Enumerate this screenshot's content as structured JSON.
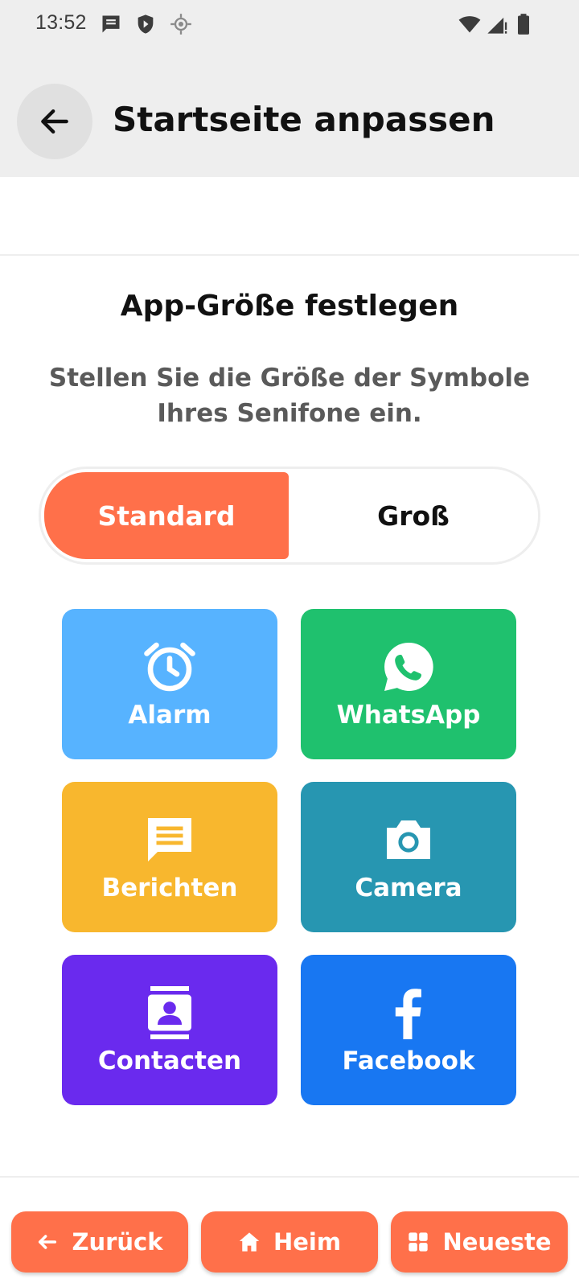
{
  "status_bar": {
    "time": "13:52",
    "icons": [
      "message-icon",
      "shield-icon",
      "location-icon",
      "wifi-icon",
      "signal-icon",
      "battery-icon"
    ]
  },
  "header": {
    "title": "Startseite anpassen",
    "back_icon": "arrow-left-icon"
  },
  "section": {
    "title": "App-Größe festlegen",
    "description": "Stellen Sie die Größe der Symbole Ihres Senifone ein."
  },
  "size_toggle": {
    "options": [
      {
        "label": "Standard",
        "selected": true
      },
      {
        "label": "Groß",
        "selected": false
      }
    ],
    "active_color": "#FF704A"
  },
  "tiles": [
    {
      "label": "Alarm",
      "icon": "alarm-clock-icon",
      "color": "#57B3FF"
    },
    {
      "label": "WhatsApp",
      "icon": "whatsapp-icon",
      "color": "#1FC16E"
    },
    {
      "label": "Berichten",
      "icon": "message-icon",
      "color": "#F8B72E"
    },
    {
      "label": "Camera",
      "icon": "camera-icon",
      "color": "#2796B1"
    },
    {
      "label": "Contacten",
      "icon": "contact-card-icon",
      "color": "#6A2AEE"
    },
    {
      "label": "Facebook",
      "icon": "facebook-icon",
      "color": "#1877F2"
    }
  ],
  "bottom_nav": [
    {
      "label": "Zurück",
      "icon": "arrow-left-icon"
    },
    {
      "label": "Heim",
      "icon": "home-icon"
    },
    {
      "label": "Neueste",
      "icon": "grid-icon"
    }
  ],
  "colors": {
    "accent": "#FF704A",
    "header_bg": "#EEEEEE"
  }
}
